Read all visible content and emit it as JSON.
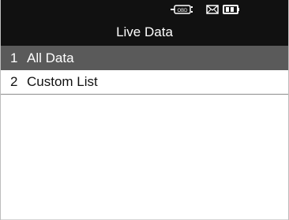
{
  "screen": {
    "title": "Live Data"
  },
  "status_bar": {
    "icons": [
      "obd-connection-icon",
      "mail-icon",
      "battery-icon"
    ]
  },
  "menu": {
    "items": [
      {
        "number": "1",
        "label": "All Data",
        "selected": true
      },
      {
        "number": "2",
        "label": "Custom List",
        "selected": false
      }
    ]
  },
  "colors": {
    "header_background": "#111111",
    "selected_row": "#5a5a5a",
    "text": "#111111",
    "header_text": "#ffffff"
  }
}
